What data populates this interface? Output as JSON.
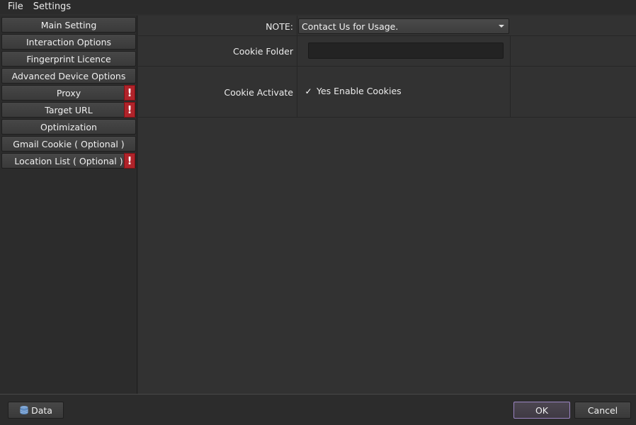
{
  "menu": {
    "items": [
      "File",
      "Settings"
    ]
  },
  "sidebar": {
    "items": [
      {
        "label": "Main Setting",
        "warning": false
      },
      {
        "label": "Interaction Options",
        "warning": false
      },
      {
        "label": "Fingerprint Licence",
        "warning": false
      },
      {
        "label": "Advanced Device Options",
        "warning": false
      },
      {
        "label": "Proxy",
        "warning": true
      },
      {
        "label": "Target URL",
        "warning": true
      },
      {
        "label": "Optimization",
        "warning": false
      },
      {
        "label": "Gmail Cookie ( Optional )",
        "warning": false
      },
      {
        "label": "Location List ( Optional )",
        "warning": true
      }
    ],
    "warning_glyph": "!"
  },
  "form": {
    "note_label": "NOTE:",
    "note_value": "Contact Us for Usage.",
    "cookie_folder_label": "Cookie Folder",
    "cookie_folder_value": "",
    "cookie_activate_label": "Cookie Activate",
    "cookie_checkbox_checked": true,
    "cookie_checkbox_glyph": "✓",
    "cookie_checkbox_label": "Yes Enable Cookies"
  },
  "footer": {
    "data_button": "Data",
    "ok_button": "OK",
    "cancel_button": "Cancel"
  },
  "colors": {
    "warning": "#b0232a",
    "ok_border": "#9b84c2",
    "db_icon": "#7fa7d6"
  }
}
